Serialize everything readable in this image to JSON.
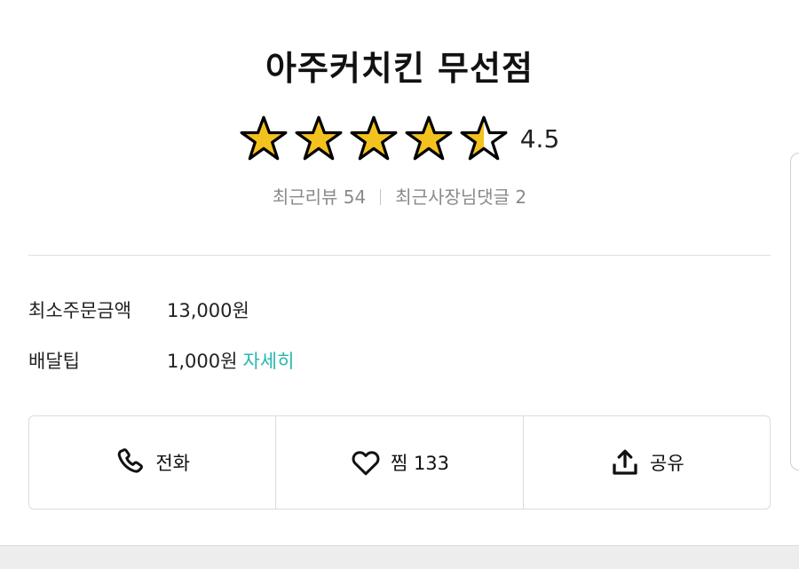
{
  "store": {
    "name": "아주커치킨 무선점",
    "rating": 4.5,
    "rating_text": "4.5",
    "star_color": "#f4c21f"
  },
  "reviews": {
    "recent_reviews": "최근리뷰 54",
    "owner_comments": "최근사장님댓글 2"
  },
  "info": {
    "min_order_label": "최소주문금액",
    "min_order_value": "13,000원",
    "delivery_tip_label": "배달팁",
    "delivery_tip_value": "1,000원",
    "detail_link": "자세히",
    "accent_color": "#2ab7b0"
  },
  "actions": {
    "call": {
      "label": "전화",
      "icon": "phone-icon"
    },
    "like": {
      "label": "찜 133",
      "icon": "heart-icon"
    },
    "share": {
      "label": "공유",
      "icon": "share-icon"
    }
  }
}
